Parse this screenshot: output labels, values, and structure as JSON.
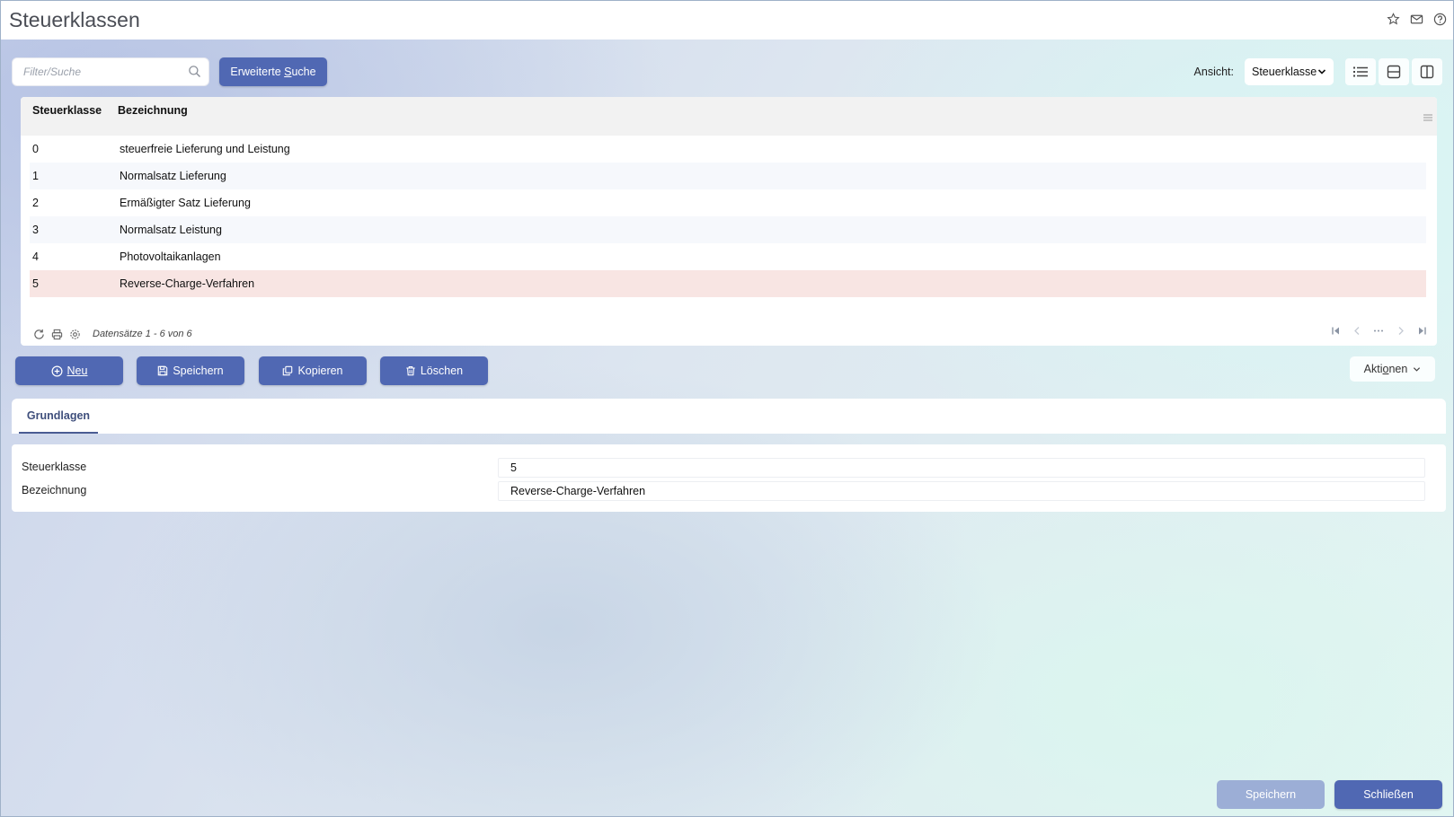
{
  "page": {
    "title": "Steuerklassen"
  },
  "search": {
    "placeholder": "Filter/Suche",
    "advanced_label_pre": "Erweiterte ",
    "advanced_label_key": "S",
    "advanced_label_post": "uche"
  },
  "view": {
    "label": "Ansicht:",
    "selected": "Steuerklasse"
  },
  "grid": {
    "columns": [
      "Steuerklasse",
      "Bezeichnung"
    ],
    "rows": [
      {
        "steuerklasse": "0",
        "bezeichnung": "steuerfreie Lieferung und Leistung"
      },
      {
        "steuerklasse": "1",
        "bezeichnung": "Normalsatz Lieferung"
      },
      {
        "steuerklasse": "2",
        "bezeichnung": "Ermäßigter Satz Lieferung"
      },
      {
        "steuerklasse": "3",
        "bezeichnung": "Normalsatz Leistung"
      },
      {
        "steuerklasse": "4",
        "bezeichnung": "Photovoltaikanlagen"
      },
      {
        "steuerklasse": "5",
        "bezeichnung": "Reverse-Charge-Verfahren"
      }
    ],
    "selected_row": 5,
    "records_text": "Datensätze 1 - 6 von 6"
  },
  "actions": {
    "neu": "Neu",
    "speichern": "Speichern",
    "kopieren": "Kopieren",
    "loeschen": "Löschen",
    "aktionen_pre": "Akti",
    "aktionen_key": "o",
    "aktionen_post": "nen"
  },
  "tabs": [
    {
      "label": "Grundlagen"
    }
  ],
  "form": {
    "steuerklasse_label": "Steuerklasse",
    "steuerklasse_value": "5",
    "bezeichnung_label": "Bezeichnung",
    "bezeichnung_value": "Reverse-Charge-Verfahren"
  },
  "footer": {
    "save_label": "Speichern",
    "close_label": "Schließen"
  },
  "colors": {
    "primary": "#5068b3",
    "primary_disabled": "#9caed6",
    "selected_row": "#f8e5e3",
    "tab_accent": "#4a5c93"
  }
}
